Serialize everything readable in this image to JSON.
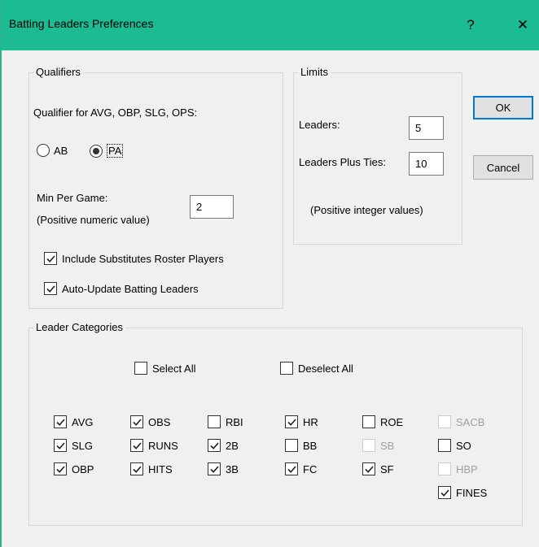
{
  "window": {
    "title": "Batting Leaders Preferences",
    "help_glyph": "?",
    "close_glyph": "✕"
  },
  "qualifiers": {
    "group_label": "Qualifiers",
    "qualifier_label": "Qualifier for AVG, OBP, SLG, OPS:",
    "options": [
      {
        "label": "AB",
        "selected": false
      },
      {
        "label": "PA",
        "selected": true
      }
    ],
    "min_per_game_label": "Min Per Game:",
    "min_per_game_hint": "(Positive numeric value)",
    "min_per_game_value": "2",
    "include_subs": {
      "label": "Include Substitutes Roster Players",
      "checked": true
    },
    "auto_update": {
      "label": "Auto-Update Batting Leaders",
      "checked": true
    }
  },
  "limits": {
    "group_label": "Limits",
    "leaders_label": "Leaders:",
    "leaders_value": "5",
    "leaders_ties_label": "Leaders Plus Ties:",
    "leaders_ties_value": "10",
    "hint": "(Positive integer values)"
  },
  "buttons": {
    "ok": "OK",
    "cancel": "Cancel"
  },
  "categories": {
    "group_label": "Leader Categories",
    "select_all": "Select All",
    "deselect_all": "Deselect All",
    "items": [
      {
        "label": "AVG",
        "checked": true,
        "enabled": true
      },
      {
        "label": "OBS",
        "checked": true,
        "enabled": true
      },
      {
        "label": "RBI",
        "checked": false,
        "enabled": true
      },
      {
        "label": "HR",
        "checked": true,
        "enabled": true
      },
      {
        "label": "ROE",
        "checked": false,
        "enabled": true
      },
      {
        "label": "SACB",
        "checked": false,
        "enabled": false
      },
      {
        "label": "SLG",
        "checked": true,
        "enabled": true
      },
      {
        "label": "RUNS",
        "checked": true,
        "enabled": true
      },
      {
        "label": "2B",
        "checked": true,
        "enabled": true
      },
      {
        "label": "BB",
        "checked": false,
        "enabled": true
      },
      {
        "label": "SB",
        "checked": false,
        "enabled": false
      },
      {
        "label": "SO",
        "checked": false,
        "enabled": true
      },
      {
        "label": "OBP",
        "checked": true,
        "enabled": true
      },
      {
        "label": "HITS",
        "checked": true,
        "enabled": true
      },
      {
        "label": "3B",
        "checked": true,
        "enabled": true
      },
      {
        "label": "FC",
        "checked": true,
        "enabled": true
      },
      {
        "label": "SF",
        "checked": true,
        "enabled": true
      },
      {
        "label": "HBP",
        "checked": false,
        "enabled": false
      },
      {
        "label": "FINES",
        "checked": true,
        "enabled": true
      }
    ]
  },
  "colors": {
    "titlebar": "#1dbb93",
    "dialog_bg": "#f0f0f0",
    "default_button_border": "#0078d7"
  }
}
